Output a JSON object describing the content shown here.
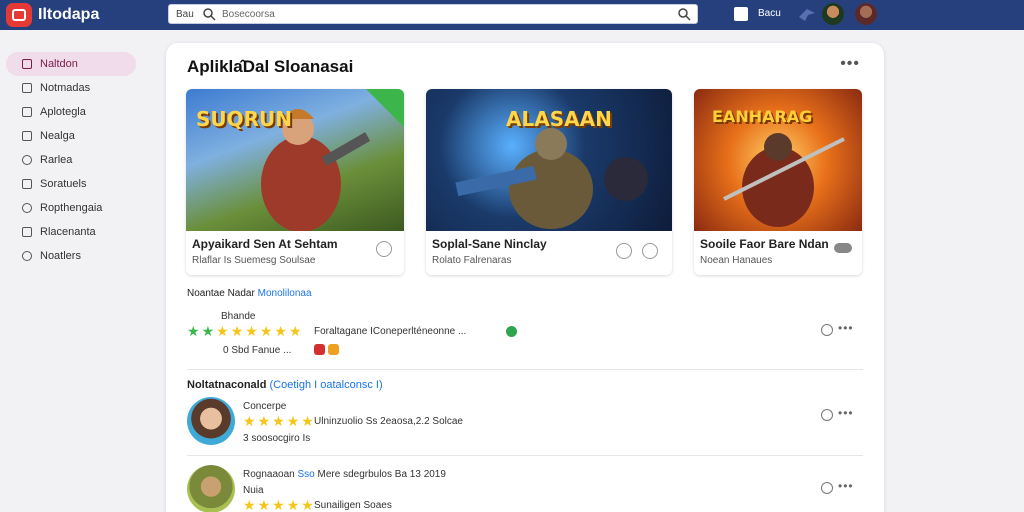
{
  "app": {
    "brand": "Iltodapa",
    "search_scope": "Bau",
    "search_placeholder": "Bosecoorsa",
    "top_label": "Bacu"
  },
  "sidebar": {
    "items": [
      {
        "label": "Naltdon",
        "icon": "lock-icon",
        "active": true
      },
      {
        "label": "Notmadas",
        "icon": "document-icon"
      },
      {
        "label": "Aplotegla",
        "icon": "page-icon"
      },
      {
        "label": "Nealga",
        "icon": "grid-icon"
      },
      {
        "label": "Rarlea",
        "icon": "tag-icon"
      },
      {
        "label": "Soratuels",
        "icon": "monitor-icon"
      },
      {
        "label": "Ropthengaia",
        "icon": "people-icon"
      },
      {
        "label": "Rlacenanta",
        "icon": "calendar-icon"
      },
      {
        "label": "Noatlers",
        "icon": "settings-icon"
      }
    ]
  },
  "main": {
    "title": "Apliklа̂Dal Sloanasai",
    "games": [
      {
        "art_text": "SUQRUN",
        "title": "Apyaikard Sen At Sehtam",
        "subtitle": "Rlaflar Is Suemesg Soulsae"
      },
      {
        "art_text": "ALASAAN",
        "title": "Soplal-Sane Ninclay",
        "subtitle": "Rolato Falrenaras"
      },
      {
        "art_text": "EANHARAG",
        "title": "Sooile Faor Bare Ndan",
        "subtitle": "Noean Hanaues"
      }
    ],
    "section1_label": "Noantae Nadar",
    "section1_link": "Monolilonaa",
    "row1_heading": "Bhande",
    "row1_text": "Foraltagane IConeperlténeonne ...",
    "row1_meta": "0 Sbd Fanue ...",
    "section2_heading": "Noltatnaconald",
    "section2_link": "(Coetigh I oatalconsc I)",
    "row2_name": "Concerpe",
    "row2_text": "Ulninzuolio Ss 2eaosa,2.2 Solcae",
    "row2_meta": "3 soosocgiro Is",
    "row3_name": "Rognaaoan",
    "row3_highlight": "Sso",
    "row3_text": "Mere sdegrbulos Ba 13 2019",
    "row3_meta": "Nuia",
    "row3_sub": "Sunailigen Soaes"
  }
}
